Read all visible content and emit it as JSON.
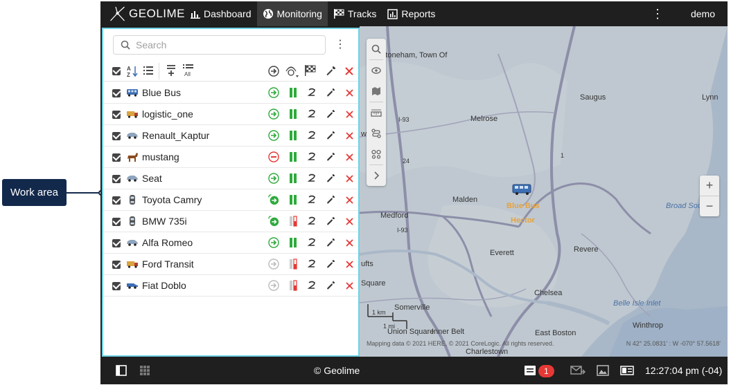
{
  "callout": {
    "label": "Work area"
  },
  "topbar": {
    "logo_text": "GEOLIME",
    "nav": [
      {
        "label": "Dashboard",
        "icon": "bar-chart-icon"
      },
      {
        "label": "Monitoring",
        "icon": "globe-icon",
        "active": true
      },
      {
        "label": "Tracks",
        "icon": "checkered-flag-icon"
      },
      {
        "label": "Reports",
        "icon": "report-icon"
      }
    ],
    "user": "demo"
  },
  "panel": {
    "search_placeholder": "Search",
    "vehicles": [
      {
        "name": "Blue Bus",
        "icon": "bus-icon",
        "motion": "moving",
        "fuel": "green"
      },
      {
        "name": "logistic_one",
        "icon": "truck-icon",
        "motion": "moving",
        "fuel": "green"
      },
      {
        "name": "Renault_Kaptur",
        "icon": "car-icon",
        "motion": "moving",
        "fuel": "green"
      },
      {
        "name": "mustang",
        "icon": "horse-icon",
        "motion": "stopped",
        "fuel": "green"
      },
      {
        "name": "Seat",
        "icon": "car-icon",
        "motion": "moving",
        "fuel": "green"
      },
      {
        "name": "Toyota Camry",
        "icon": "car-top-icon",
        "motion": "moving-alert",
        "fuel": "green"
      },
      {
        "name": "BMW 735i",
        "icon": "car-top-icon",
        "motion": "moving-alert",
        "fuel": "mixed"
      },
      {
        "name": "Alfa Romeo",
        "icon": "car-icon",
        "motion": "moving",
        "fuel": "green"
      },
      {
        "name": "Ford Transit",
        "icon": "truck-icon",
        "motion": "offline",
        "fuel": "mixed"
      },
      {
        "name": "Fiat Doblo",
        "icon": "van-icon",
        "motion": "offline",
        "fuel": "mixed"
      }
    ]
  },
  "map": {
    "labels": {
      "stoneham": "Stoneham, Town Of",
      "saugus": "Saugus",
      "lynn": "Lynn",
      "melrose": "Melrose",
      "malden": "Malden",
      "medford": "Medford",
      "everett": "Everett",
      "revere": "Revere",
      "chelsea": "Chelsea",
      "somerville": "Somerville",
      "union_square": "Union Square",
      "inner_belt": "Inner Belt",
      "east_boston": "East Boston",
      "charlestown": "Charlestown",
      "winthrop": "Winthrop",
      "broad_sound": "Broad Sound",
      "belle_isle": "Belle Isle Inlet",
      "square": "Square",
      "ufts": "ufts",
      "wn": "wn",
      "i93a": "I-93",
      "i93b": "I-93",
      "rt1": "1",
      "rt24": "24"
    },
    "unit_labels": [
      "Blue Bus",
      "Hector"
    ],
    "attribution": "Mapping data © 2021 HERE, © 2021 CoreLogic. All rights reserved.",
    "coordinates": "N 42° 25.0831' : W -070° 57.5618'",
    "scale_km": "1 km",
    "scale_mi": "1 mi"
  },
  "bottombar": {
    "copyright": "© Geolime",
    "alert_count": "1",
    "clock": "12:27:04 pm (-04)"
  },
  "colors": {
    "accent": "#6fd2e4",
    "green": "#2eaa3c",
    "red": "#e53935",
    "dark": "#1f1f1f"
  }
}
